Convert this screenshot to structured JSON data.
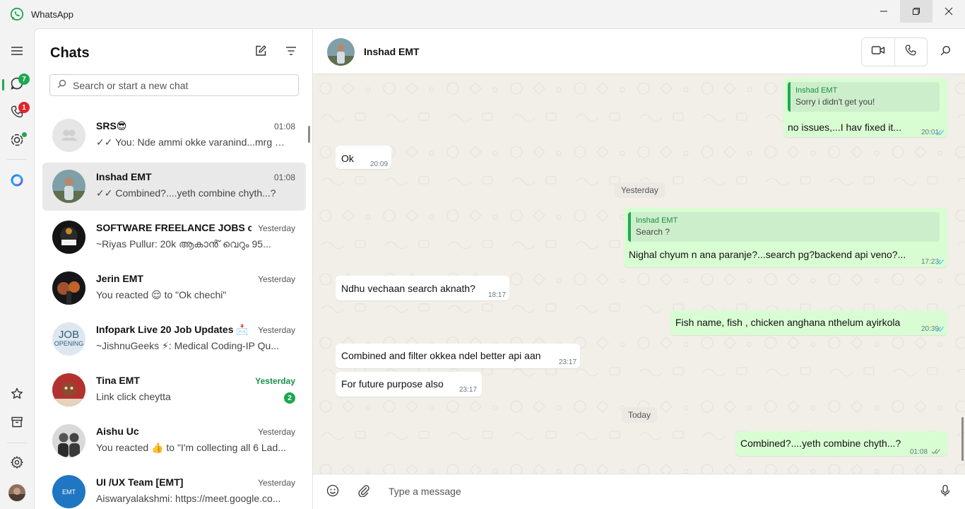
{
  "window": {
    "title": "WhatsApp",
    "controls": [
      "minimize",
      "maximize",
      "close"
    ]
  },
  "rail": {
    "items": [
      {
        "name": "menu",
        "icon": "hamburger-menu-icon"
      },
      {
        "name": "chats",
        "icon": "chat-bubble-icon",
        "badge": "7",
        "badge_color": "#1da851"
      },
      {
        "name": "calls",
        "icon": "phone-icon",
        "badge": "1",
        "badge_color": "#e0242b"
      },
      {
        "name": "status",
        "icon": "status-ring-icon"
      },
      {
        "name": "meta-ai",
        "icon": "meta-ai-ring-icon"
      },
      {
        "name": "starred",
        "icon": "star-icon"
      },
      {
        "name": "archived",
        "icon": "archive-icon"
      },
      {
        "name": "settings",
        "icon": "gear-icon"
      },
      {
        "name": "profile",
        "icon": "profile-avatar"
      }
    ]
  },
  "chatlist": {
    "title": "Chats",
    "new_chat_icon": "new-chat-icon",
    "filter_icon": "filter-icon",
    "search_placeholder": "Search or start a new chat",
    "chats": [
      {
        "name": "SRS😎",
        "time": "01:08",
        "preview": "✓✓ You: Nde ammi okke varanind...mrg n...",
        "avatar": "group-placeholder",
        "active": false
      },
      {
        "name": "Inshad EMT",
        "time": "01:08",
        "preview": "✓✓ Combined?....yeth combine chyth...?",
        "avatar": "photo",
        "active": true
      },
      {
        "name": "SOFTWARE FREELANCE JOBS c...",
        "time": "Yesterday",
        "preview": "~Riyas Pullur: 20k ആകാൻ് വെറും 95...",
        "avatar": "photo",
        "active": false
      },
      {
        "name": "Jerin EMT",
        "time": "Yesterday",
        "preview": "You reacted 😌 to \"Ok chechi\"",
        "avatar": "photo",
        "active": false
      },
      {
        "name": "Infopark Live 20 Job Updates 📩",
        "time": "Yesterday",
        "preview": "~JishnuGeeks ⚡: Medical Coding-IP  Qu...",
        "avatar": "photo",
        "active": false
      },
      {
        "name": "Tina EMT",
        "time": "Yesterday",
        "preview": "Link click cheytta",
        "avatar": "photo",
        "active": false,
        "unread": "2"
      },
      {
        "name": "Aishu Uc",
        "time": "Yesterday",
        "preview": "You reacted 👍 to \"I'm collecting all 6 Lad...",
        "avatar": "photo",
        "active": false
      },
      {
        "name": "UI /UX Team [EMT]",
        "time": "Yesterday",
        "preview": "Aiswaryalakshmi: https://meet.google.co...",
        "avatar": "logo",
        "active": false
      }
    ],
    "job_opening_avatar_text": [
      "JOB",
      "OPENING"
    ],
    "emt_avatar_text": "EMT"
  },
  "conversation": {
    "contact_name": "Inshad EMT",
    "video_call_icon": "video-camera-icon",
    "voice_call_icon": "phone-icon",
    "search_icon": "search-icon",
    "messages": [
      {
        "dir": "out",
        "quote_name": "Inshad EMT",
        "quote_text": "Sorry i didn't get you!",
        "text": "no issues,...I hav fixed it...",
        "time": "20:01",
        "status": "read"
      },
      {
        "dir": "in",
        "text": "Ok",
        "time": "20:09"
      },
      {
        "dir": "out",
        "quote_name": "Inshad EMT",
        "quote_text": "Search ?",
        "text": "Nighal chyum n ana paranje?...search pg?backend api veno?...",
        "time": "17:23",
        "status": "read"
      },
      {
        "dir": "in",
        "text": "Ndhu vechaan search aknath?",
        "time": "18:17"
      },
      {
        "dir": "out",
        "text": "Fish name, fish , chicken anghana nthelum ayirkola",
        "time": "20:39",
        "status": "read"
      },
      {
        "dir": "in",
        "text": "Combined and filter okkea ndel better api aan",
        "time": "23:17"
      },
      {
        "dir": "in",
        "text": "For future purpose also",
        "time": "23:17"
      },
      {
        "dir": "out",
        "text": "Combined?....yeth combine chyth...?",
        "time": "01:08",
        "status": "delivered"
      }
    ],
    "date_separators": [
      "Yesterday",
      "Today"
    ],
    "composer_placeholder": "Type a message",
    "emoji_icon": "smiley-icon",
    "attach_icon": "paperclip-icon",
    "mic_icon": "microphone-icon"
  },
  "colors": {
    "accent": "#1da851",
    "outgoing_bubble": "#d9fdd3",
    "incoming_bubble": "#ffffff",
    "chat_bg": "#f2efe9",
    "badge_red": "#e0242b",
    "read_ticks": "#53bdeb"
  }
}
